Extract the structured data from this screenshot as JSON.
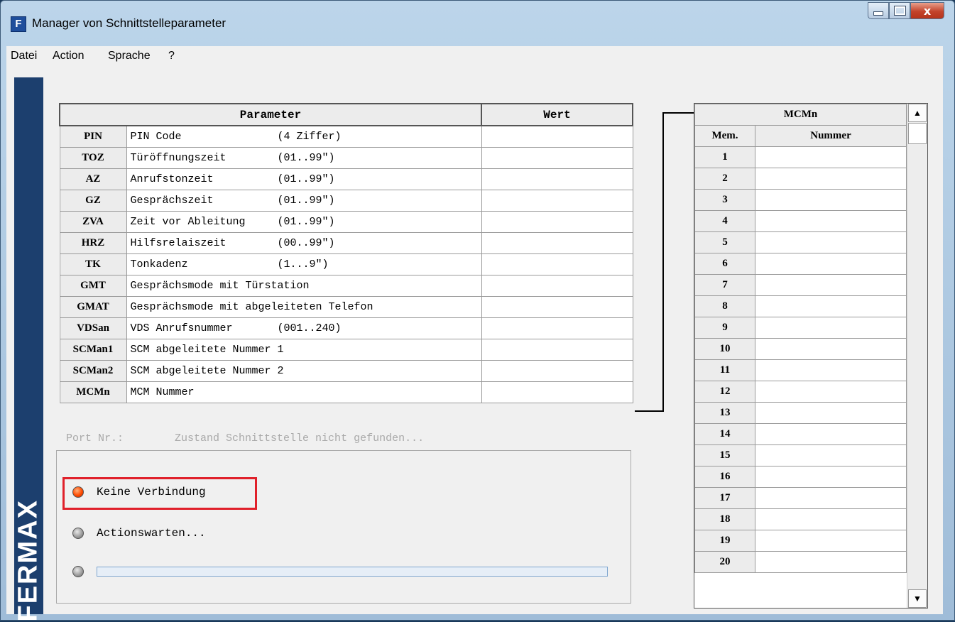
{
  "window": {
    "title": "Manager von Schnittstelleparameter",
    "app_icon": "F",
    "close_glyph": "x"
  },
  "menu": [
    "Datei",
    "Action",
    "Sprache",
    "?"
  ],
  "brand": "FERMAX",
  "params": {
    "header_param": "Parameter",
    "header_value": "Wert",
    "rows": [
      {
        "code": "PIN",
        "desc": "PIN Code               (4 Ziffer)"
      },
      {
        "code": "TOZ",
        "desc": "Türöffnungszeit        (01..99\")"
      },
      {
        "code": "AZ",
        "desc": "Anrufstonzeit          (01..99\")"
      },
      {
        "code": "GZ",
        "desc": "Gesprächszeit          (01..99\")"
      },
      {
        "code": "ZVA",
        "desc": "Zeit vor Ableitung     (01..99\")"
      },
      {
        "code": "HRZ",
        "desc": "Hilfsrelaiszeit        (00..99\")"
      },
      {
        "code": "TK",
        "desc": "Tonkadenz              (1...9\")"
      },
      {
        "code": "GMT",
        "desc": "Gesprächsmode mit Türstation"
      },
      {
        "code": "GMAT",
        "desc": "Gesprächsmode mit abgeleiteten Telefon"
      },
      {
        "code": "VDSan",
        "desc": "VDS Anrufsnummer       (001..240)"
      },
      {
        "code": "SCMan1",
        "desc": "SCM abgeleitete Nummer 1"
      },
      {
        "code": "SCMan2",
        "desc": "SCM abgeleitete Nummer 2"
      },
      {
        "code": "MCMn",
        "desc": "MCM Nummer"
      }
    ]
  },
  "status": {
    "port_line": "Port Nr.:        Zustand Schnittstelle nicht gefunden...",
    "connection": "Keine Verbindung",
    "action": "Actionswarten...",
    "progress": 0
  },
  "mcm": {
    "title": "MCMn",
    "col_mem": "Mem.",
    "col_num": "Nummer",
    "mems": [
      "1",
      "2",
      "3",
      "4",
      "5",
      "6",
      "7",
      "8",
      "9",
      "10",
      "11",
      "12",
      "13",
      "14",
      "15",
      "16",
      "17",
      "18",
      "19",
      "20"
    ],
    "scroll_up": "▲",
    "scroll_down": "▼"
  }
}
